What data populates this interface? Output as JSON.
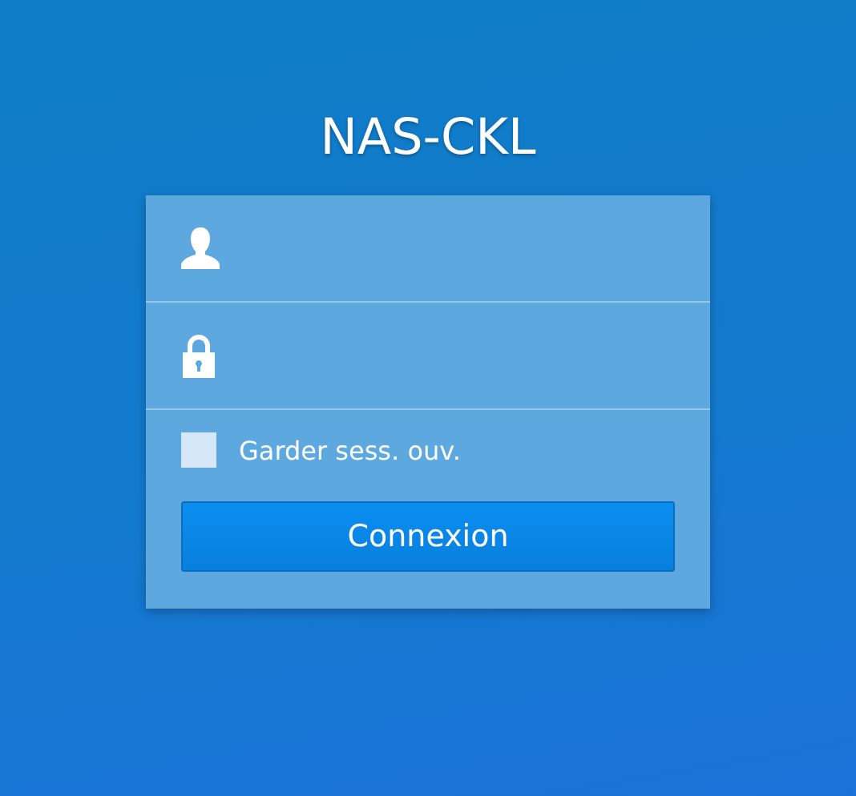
{
  "title": "NAS-CKL",
  "fields": [
    {
      "kind": "username"
    },
    {
      "kind": "password"
    }
  ],
  "remember": {
    "label": "Garder sess. ouv.",
    "checked": false
  },
  "button": {
    "label": "Connexion"
  }
}
